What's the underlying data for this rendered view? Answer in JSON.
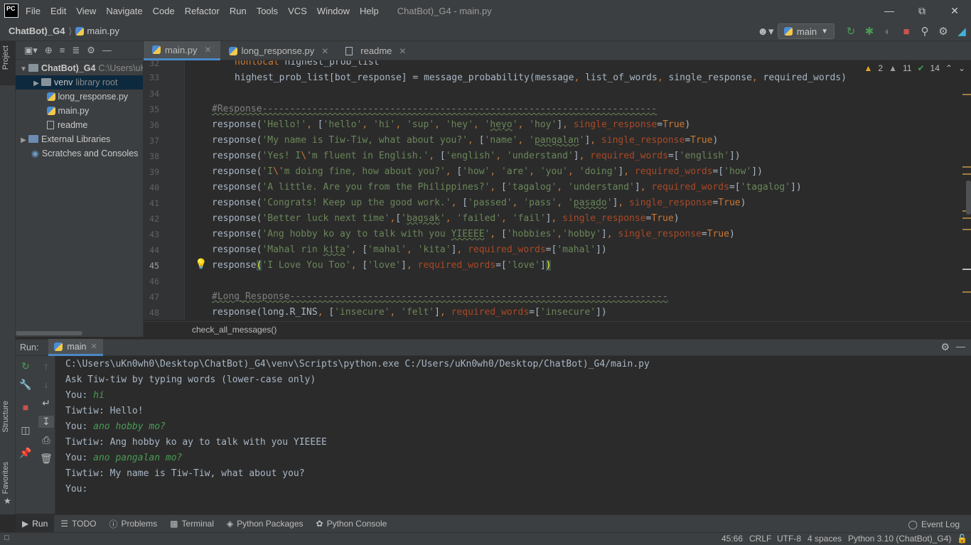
{
  "menubar": {
    "logo": "PC",
    "items": [
      "File",
      "Edit",
      "View",
      "Navigate",
      "Code",
      "Refactor",
      "Run",
      "Tools",
      "VCS",
      "Window",
      "Help"
    ],
    "window_title": "ChatBot)_G4 - main.py"
  },
  "navbar": {
    "project": "ChatBot)_G4",
    "file": "main.py",
    "run_config": "main"
  },
  "left_strip": {
    "project_label": "Project",
    "structure_label": "Structure",
    "favorites_label": "Favorites"
  },
  "project_tree": [
    {
      "label": "ChatBot)_G4",
      "extra": "C:\\Users\\uK",
      "type": "folder-root"
    },
    {
      "label": "venv",
      "extra": "library root",
      "type": "folder"
    },
    {
      "label": "long_response.py",
      "extra": "",
      "type": "py"
    },
    {
      "label": "main.py",
      "extra": "",
      "type": "py"
    },
    {
      "label": "readme",
      "extra": "",
      "type": "file"
    },
    {
      "label": "External Libraries",
      "extra": "",
      "type": "lib"
    },
    {
      "label": "Scratches and Consoles",
      "extra": "",
      "type": "scratch"
    }
  ],
  "editor_tabs": [
    "main.py",
    "long_response.py",
    "readme"
  ],
  "inspections": {
    "warnings": "2",
    "weak": "11",
    "ok": "14"
  },
  "line_numbers": [
    "32",
    "33",
    "34",
    "35",
    "36",
    "37",
    "38",
    "39",
    "40",
    "41",
    "42",
    "43",
    "44",
    "45",
    "46",
    "47",
    "48"
  ],
  "breadcrumb": "check_all_messages()",
  "run_panel": {
    "label": "Run:",
    "tab": "main",
    "console": [
      {
        "text": "C:\\Users\\uKn0wh0\\Desktop\\ChatBot)_G4\\venv\\Scripts\\python.exe C:/Users/uKn0wh0/Desktop/ChatBot)_G4/main.py",
        "input": ""
      },
      {
        "text": "Ask Tiw-tiw by typing words (lower-case only)",
        "input": ""
      },
      {
        "text": "You: ",
        "input": "hi"
      },
      {
        "text": "Tiwtiw: Hello!",
        "input": ""
      },
      {
        "text": "You: ",
        "input": "ano hobby mo?"
      },
      {
        "text": "Tiwtiw: Ang hobby ko ay to talk with you YIEEEE",
        "input": ""
      },
      {
        "text": "You: ",
        "input": "ano pangalan mo?"
      },
      {
        "text": "Tiwtiw: My name is Tiw-Tiw, what about you?",
        "input": ""
      },
      {
        "text": "You: ",
        "input": ""
      }
    ]
  },
  "bottom_tabs": [
    "Run",
    "TODO",
    "Problems",
    "Terminal",
    "Python Packages",
    "Python Console"
  ],
  "event_log": "Event Log",
  "status": {
    "position": "45:66",
    "line_sep": "CRLF",
    "encoding": "UTF-8",
    "indent": "4 spaces",
    "interpreter": "Python 3.10 (ChatBot)_G4)"
  }
}
